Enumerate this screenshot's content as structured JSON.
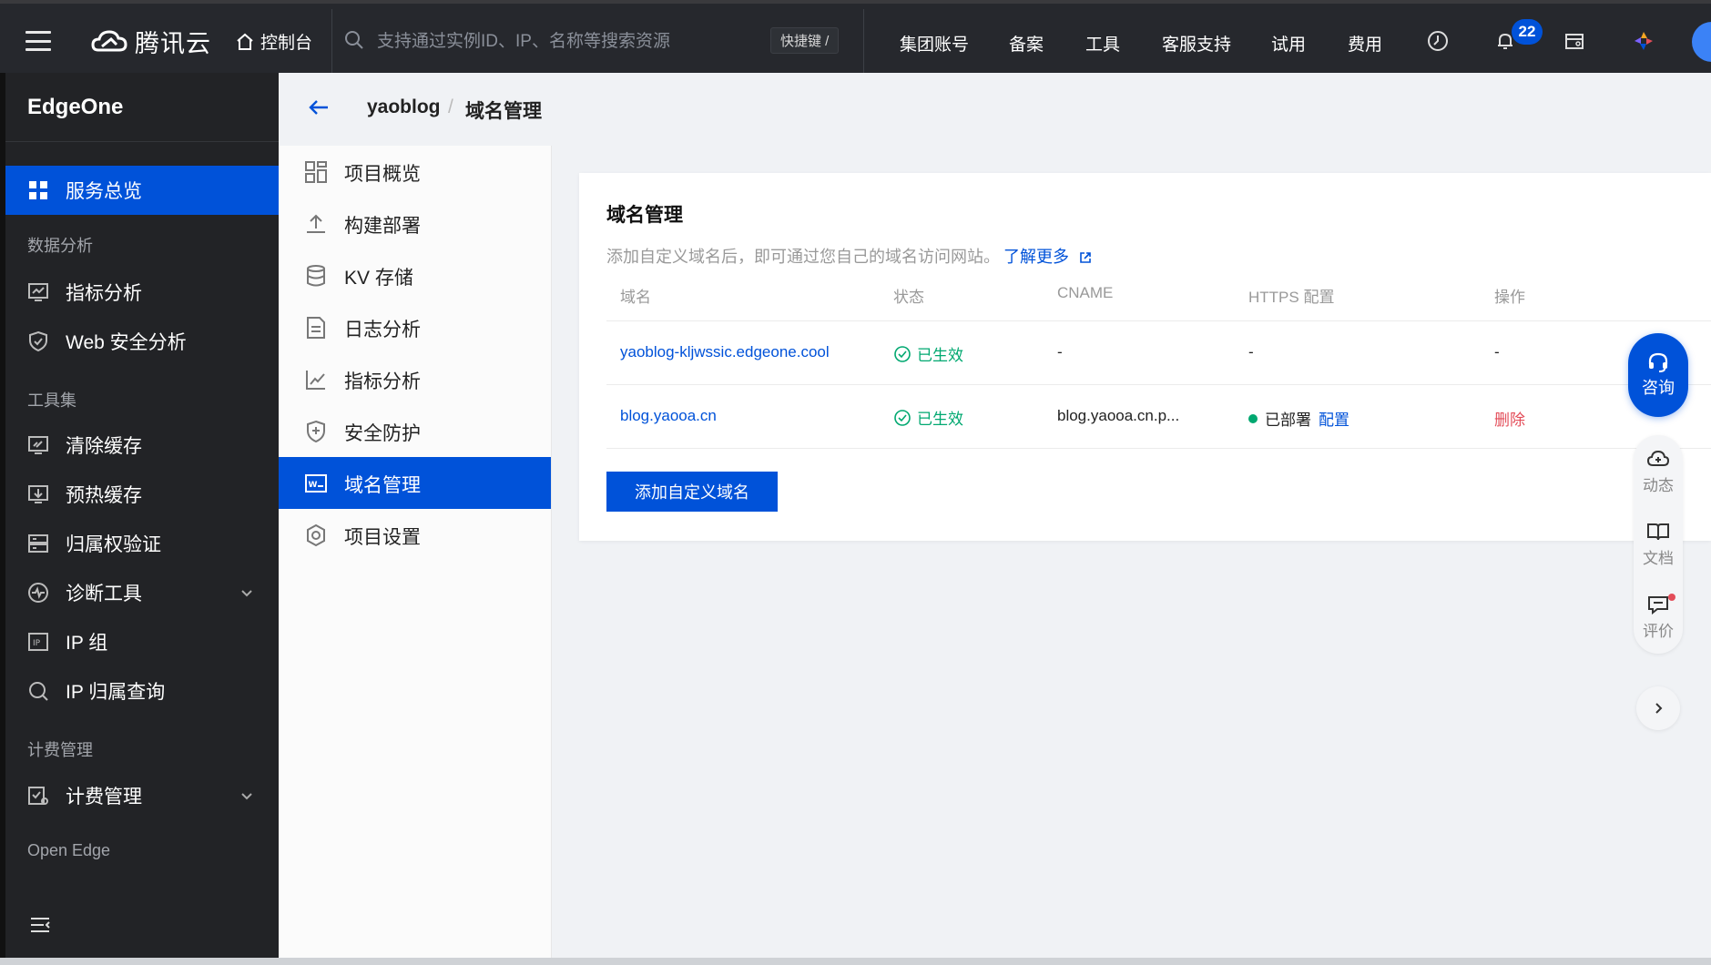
{
  "topbar": {
    "brand": "腾讯云",
    "console": "控制台",
    "search_placeholder": "支持通过实例ID、IP、名称等搜索资源",
    "shortcut": "快捷键 /",
    "nav": [
      "集团账号",
      "备案",
      "工具",
      "客服支持",
      "试用",
      "费用"
    ],
    "notification_count": "22",
    "icons": [
      "menu-icon",
      "cloud-logo-icon",
      "home-icon",
      "search-icon",
      "history-icon",
      "bell-icon",
      "calendar-icon",
      "app-icon"
    ]
  },
  "sidebar": {
    "product": "EdgeOne",
    "items": [
      {
        "label": "服务总览",
        "icon": "grid-icon",
        "active": true
      },
      {
        "group": "数据分析"
      },
      {
        "label": "指标分析",
        "icon": "monitor-icon"
      },
      {
        "label": "Web 安全分析",
        "icon": "shield-icon"
      },
      {
        "group": "工具集"
      },
      {
        "label": "清除缓存",
        "icon": "clear-cache-icon"
      },
      {
        "label": "预热缓存",
        "icon": "preheat-cache-icon"
      },
      {
        "label": "归属权验证",
        "icon": "verify-icon"
      },
      {
        "label": "诊断工具",
        "icon": "diagnose-icon",
        "expandable": true
      },
      {
        "label": "IP 组",
        "icon": "ip-group-icon"
      },
      {
        "label": "IP 归属查询",
        "icon": "search-icon"
      },
      {
        "group": "计费管理"
      },
      {
        "label": "计费管理",
        "icon": "billing-icon",
        "expandable": true
      },
      {
        "group": "Open Edge"
      }
    ]
  },
  "subnav": {
    "items": [
      {
        "label": "项目概览",
        "icon": "overview-icon"
      },
      {
        "label": "构建部署",
        "icon": "upload-icon"
      },
      {
        "label": "KV 存储",
        "icon": "database-icon"
      },
      {
        "label": "日志分析",
        "icon": "log-icon"
      },
      {
        "label": "指标分析",
        "icon": "chart-line-icon"
      },
      {
        "label": "安全防护",
        "icon": "shield-plus-icon"
      },
      {
        "label": "域名管理",
        "icon": "www-icon",
        "active": true
      },
      {
        "label": "项目设置",
        "icon": "settings-icon"
      }
    ]
  },
  "breadcrumb": {
    "project": "yaoblog",
    "separator": "/",
    "current": "域名管理"
  },
  "main": {
    "title": "域名管理",
    "description": "添加自定义域名后，即可通过您自己的域名访问网站。",
    "learn_more": "了解更多",
    "columns": [
      "域名",
      "状态",
      "CNAME",
      "HTTPS 配置",
      "操作"
    ],
    "rows": [
      {
        "domain": "yaoblog-kljwssic.edgeone.cool",
        "status": "已生效",
        "cname": "-",
        "https": "-",
        "action": "-"
      },
      {
        "domain": "blog.yaooa.cn",
        "status": "已生效",
        "cname": "blog.yaooa.cn.p...",
        "https": "已部署",
        "https_link": "配置",
        "action": "删除"
      }
    ],
    "add_button": "添加自定义域名"
  },
  "float_tools": {
    "consult": "咨询",
    "items": [
      "动态",
      "文档",
      "评价"
    ]
  },
  "colors": {
    "topbar_bg": "#26282d",
    "sidebar_bg": "#222326",
    "accent": "#0052d9",
    "success": "#00a870",
    "danger": "#e34d59"
  }
}
